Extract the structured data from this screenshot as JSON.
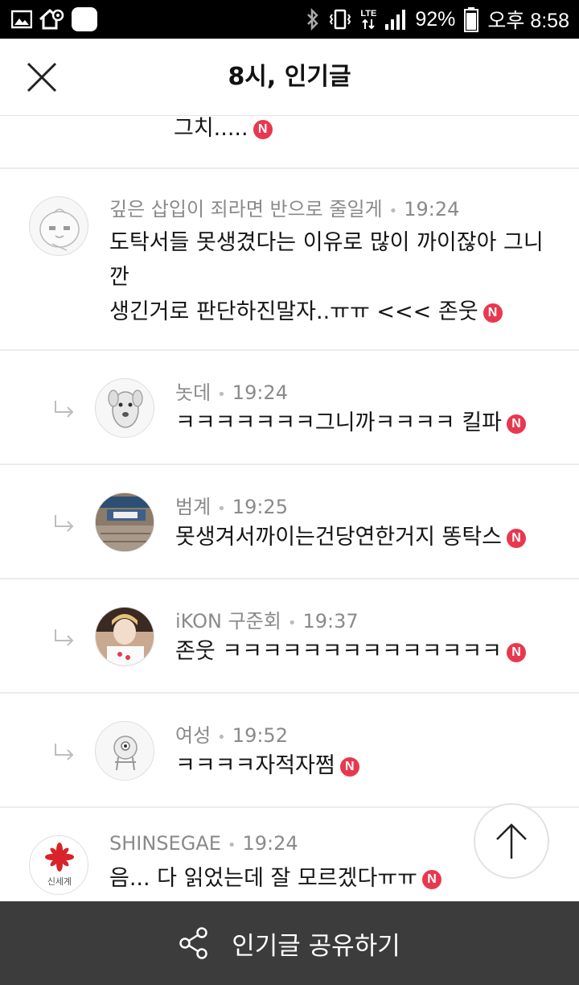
{
  "status_bar": {
    "battery": "92%",
    "time": "오후 8:58",
    "network": "LTE"
  },
  "header": {
    "title": "8시, 인기글"
  },
  "comments": [
    {
      "text": "그치....."
    },
    {
      "author": "깊은 삽입이 죄라면 반으로 줄일게",
      "time": "19:24",
      "line1": "도탁서들 못생겼다는 이유로 많이 까이잖아 그니",
      "line2": "깐",
      "line3": "생긴거로 판단하진말자..ㅠㅠ <<< 존웃"
    },
    {
      "author": "놋데",
      "time": "19:24",
      "text": "ㅋㅋㅋㅋㅋㅋㅋ그니까ㅋㅋㅋㅋ 킬파"
    },
    {
      "author": "범계",
      "time": "19:25",
      "text": "못생겨서까이는건당연한거지 똥탁스"
    },
    {
      "author": "iKON 구준회",
      "time": "19:37",
      "text": "존웃 ㅋㅋㅋㅋㅋㅋㅋㅋㅋㅋㅋㅋㅋㅋ"
    },
    {
      "author": "여성",
      "time": "19:52",
      "text": "ㅋㅋㅋㅋ자적자쩜"
    },
    {
      "author": "SHINSEGAE",
      "time": "19:24",
      "text": "음... 다 읽었는데 잘 모르겠다ㅠㅠ",
      "avatar_text": "신세계"
    }
  ],
  "badge_letter": "N",
  "bottom_bar": {
    "share_label": "인기글 공유하기"
  },
  "colors": {
    "badge": "#e8384f",
    "bottom_bar": "#3c3c3c",
    "meta_text": "#8a8a8a"
  }
}
